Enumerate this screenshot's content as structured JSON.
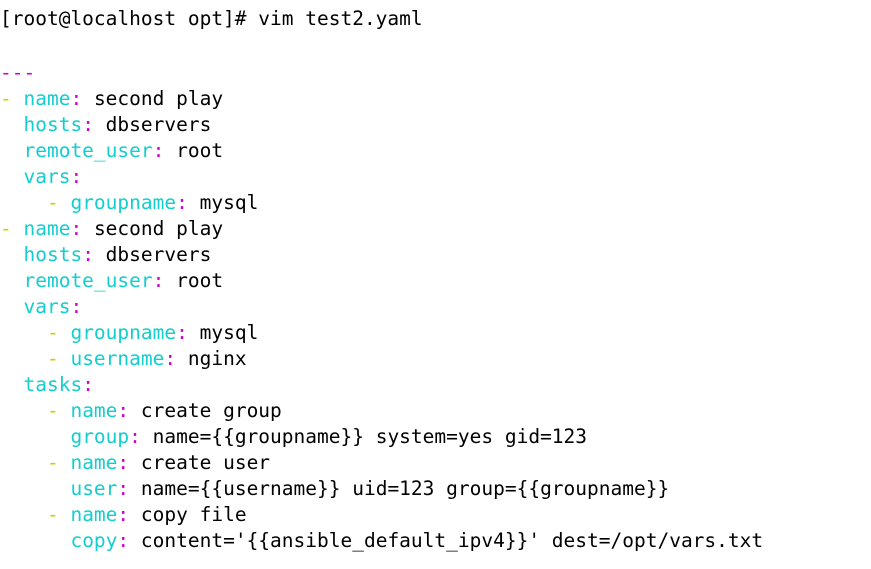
{
  "terminal": {
    "background_color": "#ffffff",
    "default_text_color": "#000000",
    "prompt": "[root@localhost opt]# vim test2.yaml",
    "colors": {
      "key": "#14cdcd",
      "colon": "#cc00cc",
      "dash": "#cccc00",
      "document_marker": "#cc00cc",
      "value": "#000000"
    }
  },
  "file": {
    "name": "test2.yaml",
    "editor": "vim",
    "lines": [
      {
        "indent": "",
        "marker": "",
        "key": "",
        "colon": "",
        "value": "",
        "doc": "---",
        "raw": "---"
      },
      {
        "indent": "",
        "marker": "- ",
        "key": "name",
        "colon": ": ",
        "value": "second play",
        "raw": "- name: second play"
      },
      {
        "indent": "  ",
        "marker": "",
        "key": "hosts",
        "colon": ": ",
        "value": "dbservers",
        "raw": "  hosts: dbservers"
      },
      {
        "indent": "  ",
        "marker": "",
        "key": "remote_user",
        "colon": ": ",
        "value": "root",
        "raw": "  remote_user: root"
      },
      {
        "indent": "  ",
        "marker": "",
        "key": "vars",
        "colon": ":",
        "value": "",
        "raw": "  vars:"
      },
      {
        "indent": "    ",
        "marker": "- ",
        "key": "groupname",
        "colon": ": ",
        "value": "mysql",
        "raw": "    - groupname: mysql"
      },
      {
        "indent": "",
        "marker": "- ",
        "key": "name",
        "colon": ": ",
        "value": "second play",
        "raw": "- name: second play"
      },
      {
        "indent": "  ",
        "marker": "",
        "key": "hosts",
        "colon": ": ",
        "value": "dbservers",
        "raw": "  hosts: dbservers"
      },
      {
        "indent": "  ",
        "marker": "",
        "key": "remote_user",
        "colon": ": ",
        "value": "root",
        "raw": "  remote_user: root"
      },
      {
        "indent": "  ",
        "marker": "",
        "key": "vars",
        "colon": ":",
        "value": "",
        "raw": "  vars:"
      },
      {
        "indent": "    ",
        "marker": "- ",
        "key": "groupname",
        "colon": ": ",
        "value": "mysql",
        "raw": "    - groupname: mysql"
      },
      {
        "indent": "    ",
        "marker": "- ",
        "key": "username",
        "colon": ": ",
        "value": "nginx",
        "raw": "    - username: nginx"
      },
      {
        "indent": "  ",
        "marker": "",
        "key": "tasks",
        "colon": ":",
        "value": "",
        "raw": "  tasks:"
      },
      {
        "indent": "    ",
        "marker": "- ",
        "key": "name",
        "colon": ": ",
        "value": "create group",
        "raw": "    - name: create group"
      },
      {
        "indent": "      ",
        "marker": "",
        "key": "group",
        "colon": ": ",
        "value": "name={{groupname}} system=yes gid=123",
        "raw": "      group: name={{groupname}} system=yes gid=123"
      },
      {
        "indent": "    ",
        "marker": "- ",
        "key": "name",
        "colon": ": ",
        "value": "create user",
        "raw": "    - name: create user"
      },
      {
        "indent": "      ",
        "marker": "",
        "key": "user",
        "colon": ": ",
        "value": "name={{username}} uid=123 group={{groupname}}",
        "raw": "      user: name={{username}} uid=123 group={{groupname}}"
      },
      {
        "indent": "    ",
        "marker": "- ",
        "key": "name",
        "colon": ": ",
        "value": "copy file",
        "raw": "    - name: copy file"
      },
      {
        "indent": "      ",
        "marker": "",
        "key": "copy",
        "colon": ": ",
        "value": "content='{{ansible_default_ipv4}}' dest=/opt/vars.txt",
        "raw": "      copy: content='{{ansible_default_ipv4}}' dest=/opt/vars.txt"
      }
    ]
  }
}
